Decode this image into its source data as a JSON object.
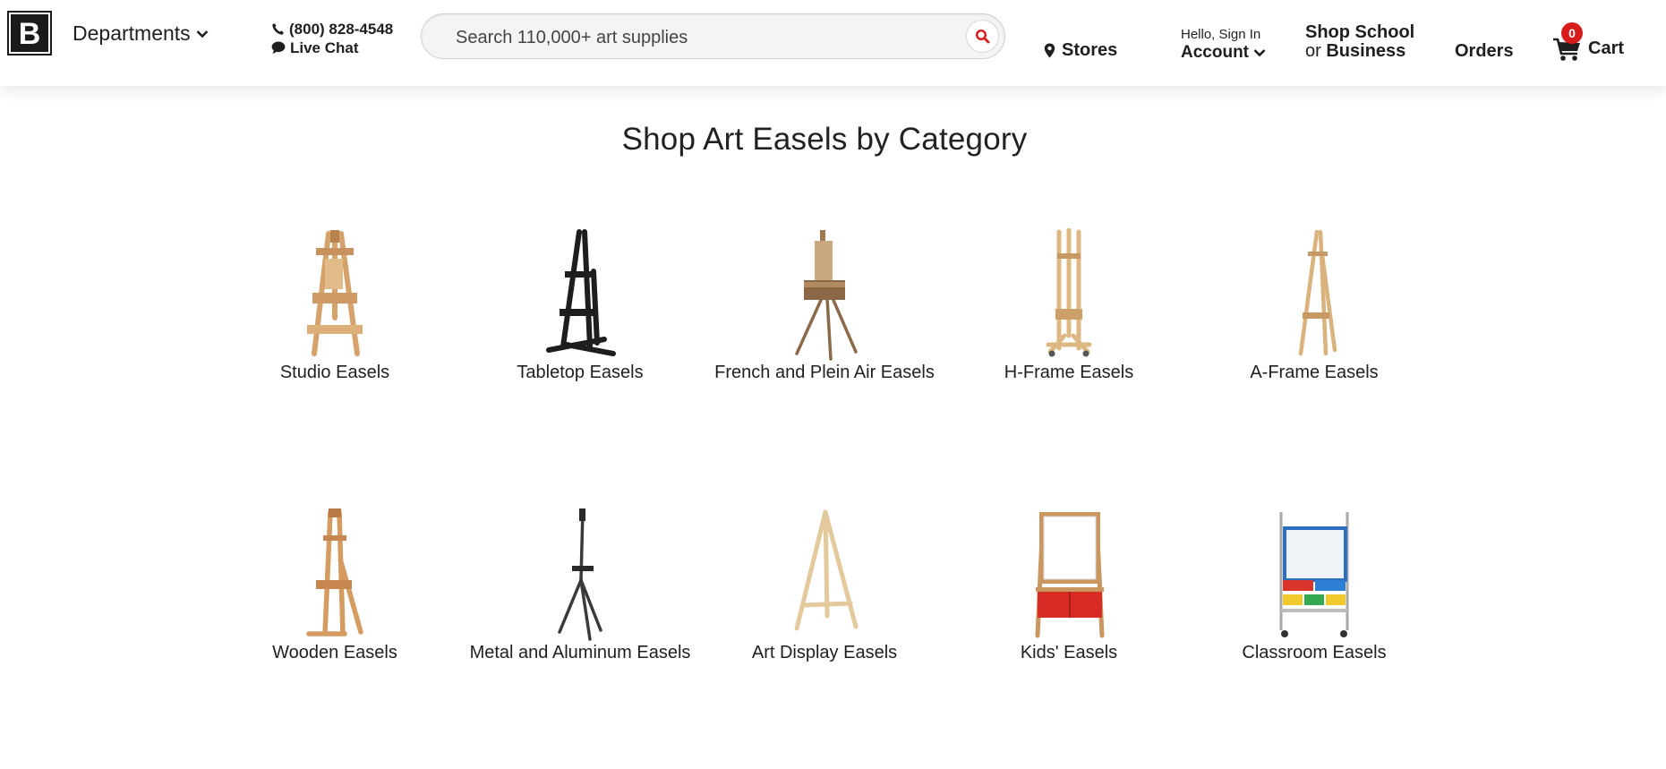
{
  "header": {
    "logo_letter": "B",
    "departments_label": "Departments",
    "phone": "(800) 828-4548",
    "live_chat": "Live Chat",
    "search_placeholder": "Search 110,000+ art supplies",
    "stores_label": "Stores",
    "account_greeting": "Hello, Sign In",
    "account_label": "Account",
    "shop_school_line1": "Shop School",
    "shop_school_or": "or",
    "shop_school_business": "Business",
    "orders_label": "Orders",
    "cart_label": "Cart",
    "cart_count": "0",
    "accent_color": "#d81b1b"
  },
  "main": {
    "title": "Shop Art Easels by Category",
    "categories": [
      {
        "label": "Studio Easels",
        "icon": "studio-easel-image"
      },
      {
        "label": "Tabletop Easels",
        "icon": "tabletop-easel-image"
      },
      {
        "label": "French and Plein Air Easels",
        "icon": "french-easel-image"
      },
      {
        "label": "H-Frame Easels",
        "icon": "h-frame-easel-image"
      },
      {
        "label": "A-Frame Easels",
        "icon": "a-frame-easel-image"
      },
      {
        "label": "Wooden Easels",
        "icon": "wooden-easel-image"
      },
      {
        "label": "Metal and Aluminum Easels",
        "icon": "metal-easel-image"
      },
      {
        "label": "Art Display Easels",
        "icon": "display-easel-image"
      },
      {
        "label": "Kids' Easels",
        "icon": "kids-easel-image"
      },
      {
        "label": "Classroom Easels",
        "icon": "classroom-easel-image"
      }
    ]
  }
}
